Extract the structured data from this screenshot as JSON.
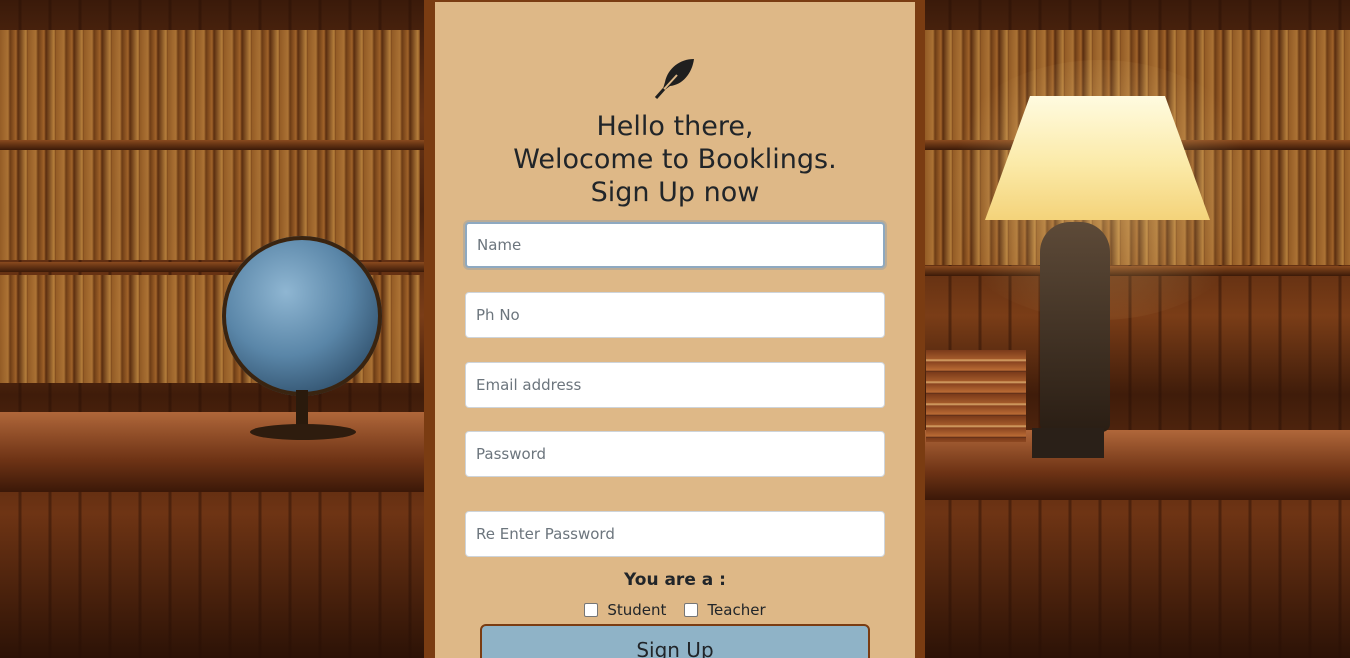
{
  "brand": {
    "logo_icon": "feather-icon"
  },
  "heading": {
    "line1": "Hello there,",
    "line2": "Welocome to Booklings.",
    "line3": "Sign Up now"
  },
  "form": {
    "name_placeholder": "Name",
    "phone_placeholder": "Ph No",
    "email_placeholder": "Email address",
    "password_placeholder": "Password",
    "reenter_password_placeholder": "Re Enter Password",
    "role_label": "You are a :",
    "roles": [
      {
        "label": "Student",
        "checked": false
      },
      {
        "label": "Teacher",
        "checked": false
      }
    ],
    "submit_label": "Sign Up"
  },
  "colors": {
    "panel_background": "#deb887",
    "panel_border": "#7a3c12",
    "button_background": "#8fb3c7"
  }
}
